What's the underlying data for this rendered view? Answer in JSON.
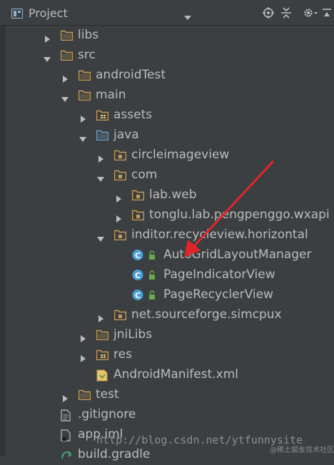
{
  "panel": {
    "title": "Project",
    "toolbar_icons": [
      "target-icon",
      "collapse-all-icon",
      "gear-icon",
      "hide-panel-icon"
    ]
  },
  "tree": [
    {
      "label": "libs",
      "icon": "folder",
      "arrow": "right"
    },
    {
      "label": "src",
      "icon": "folder",
      "arrow": "down"
    },
    {
      "label": "androidTest",
      "icon": "folder",
      "arrow": "right"
    },
    {
      "label": "main",
      "icon": "folder",
      "arrow": "down"
    },
    {
      "label": "assets",
      "icon": "resource-folder",
      "arrow": "right"
    },
    {
      "label": "java",
      "icon": "source-folder",
      "arrow": "down"
    },
    {
      "label": "circleimageview",
      "icon": "package",
      "arrow": "right"
    },
    {
      "label": "com",
      "icon": "package",
      "arrow": "down"
    },
    {
      "label": "lab.web",
      "icon": "package",
      "arrow": "right"
    },
    {
      "label": "tonglu.lab.pengpenggo.wxapi",
      "icon": "package",
      "arrow": "right"
    },
    {
      "label": "inditor.recycleview.horizontal",
      "icon": "package",
      "arrow": "down"
    },
    {
      "label": "AutoGridLayoutManager",
      "icon": "class",
      "arrow": "none"
    },
    {
      "label": "PageIndicatorView",
      "icon": "class",
      "arrow": "none"
    },
    {
      "label": "PageRecyclerView",
      "icon": "class",
      "arrow": "none"
    },
    {
      "label": "net.sourceforge.simcpux",
      "icon": "package",
      "arrow": "right"
    },
    {
      "label": "jniLibs",
      "icon": "folder",
      "arrow": "right"
    },
    {
      "label": "res",
      "icon": "resource-folder",
      "arrow": "right"
    },
    {
      "label": "AndroidManifest.xml",
      "icon": "manifest-file",
      "arrow": "none"
    },
    {
      "label": "test",
      "icon": "folder",
      "arrow": "right"
    },
    {
      "label": ".gitignore",
      "icon": "text-file",
      "arrow": "none"
    },
    {
      "label": "app.iml",
      "icon": "iml-file",
      "arrow": "none"
    },
    {
      "label": "build.gradle",
      "icon": "gradle-file",
      "arrow": "none"
    }
  ],
  "watermark": "http://blog.csdn.net/ytfunnysite",
  "watermark_small": "@稀土掘金技术社区",
  "colors": {
    "background": "#3c3f41",
    "text": "#bbbbbb",
    "folder": "#c59a52",
    "source_folder": "#6d9fc9",
    "class_icon": "#4a9fd5",
    "lock_green": "#6aa84f",
    "annotation_arrow": "#e0252a"
  }
}
